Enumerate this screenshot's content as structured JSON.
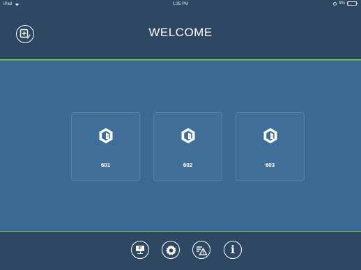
{
  "status_bar": {
    "device": "iPad",
    "time": "1:35 PM",
    "battery_percent": "9%",
    "battery_level": 0.09
  },
  "header": {
    "title": "WELCOME",
    "edit_icon": "edit-list-icon"
  },
  "rooms": [
    {
      "label": "601",
      "icon": "room-door-icon"
    },
    {
      "label": "602",
      "icon": "room-door-icon"
    },
    {
      "label": "603",
      "icon": "room-door-icon"
    }
  ],
  "footer": {
    "ip_label": "IP",
    "buttons": [
      "ip-settings-icon",
      "gear-icon",
      "alarm-list-icon",
      "info-icon"
    ],
    "info_glyph": "i"
  },
  "colors": {
    "header_bg": "#2e4863",
    "main_bg": "#3a6a93",
    "card_bg": "#3f6f98",
    "accent_green": "#6abf3a",
    "battery_low": "#e04848"
  }
}
